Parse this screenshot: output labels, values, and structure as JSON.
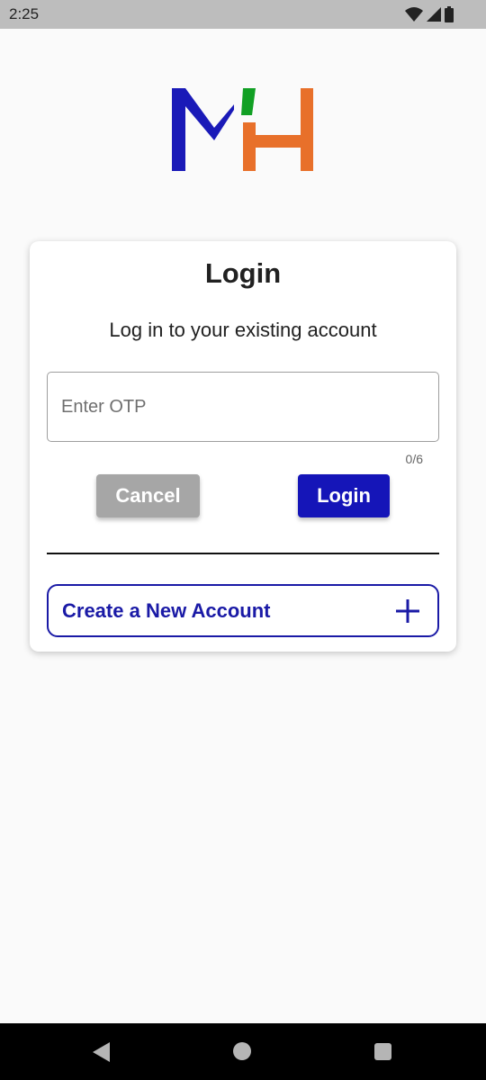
{
  "status_bar": {
    "time": "2:25",
    "icons": [
      "wifi-icon",
      "signal-icon",
      "battery-icon"
    ]
  },
  "logo": {
    "text": "MH",
    "colors": {
      "m": "#1a1ab8",
      "accent": "#11a024",
      "h": "#e8702a"
    }
  },
  "login_card": {
    "title": "Login",
    "subtitle": "Log in to your existing account",
    "otp_input": {
      "placeholder": "Enter OTP",
      "value": "",
      "counter": "0/6"
    },
    "cancel_label": "Cancel",
    "login_label": "Login",
    "create_account_label": "Create a New Account",
    "create_account_icon": "plus-icon"
  },
  "colors": {
    "primary": "#1515b8",
    "cancel_gray": "#a6a6a6",
    "background": "#fafafa"
  },
  "nav_bar": {
    "buttons": [
      "back-icon",
      "home-icon",
      "recents-icon"
    ]
  }
}
